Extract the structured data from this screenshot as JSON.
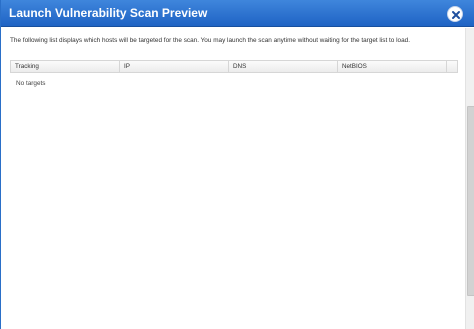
{
  "dialog": {
    "title": "Launch Vulnerability Scan Preview",
    "close_icon": "close-icon"
  },
  "main": {
    "description": "The following list displays which hosts will be targeted for the scan. You may launch the scan anytime without waiting for the target list to load.",
    "table": {
      "columns": [
        "Tracking",
        "IP",
        "DNS",
        "NetBIOS"
      ],
      "rows": [],
      "empty_text": "No targets"
    }
  },
  "colors": {
    "titlebar": "#2f75d4",
    "title_text": "#ffffff"
  }
}
